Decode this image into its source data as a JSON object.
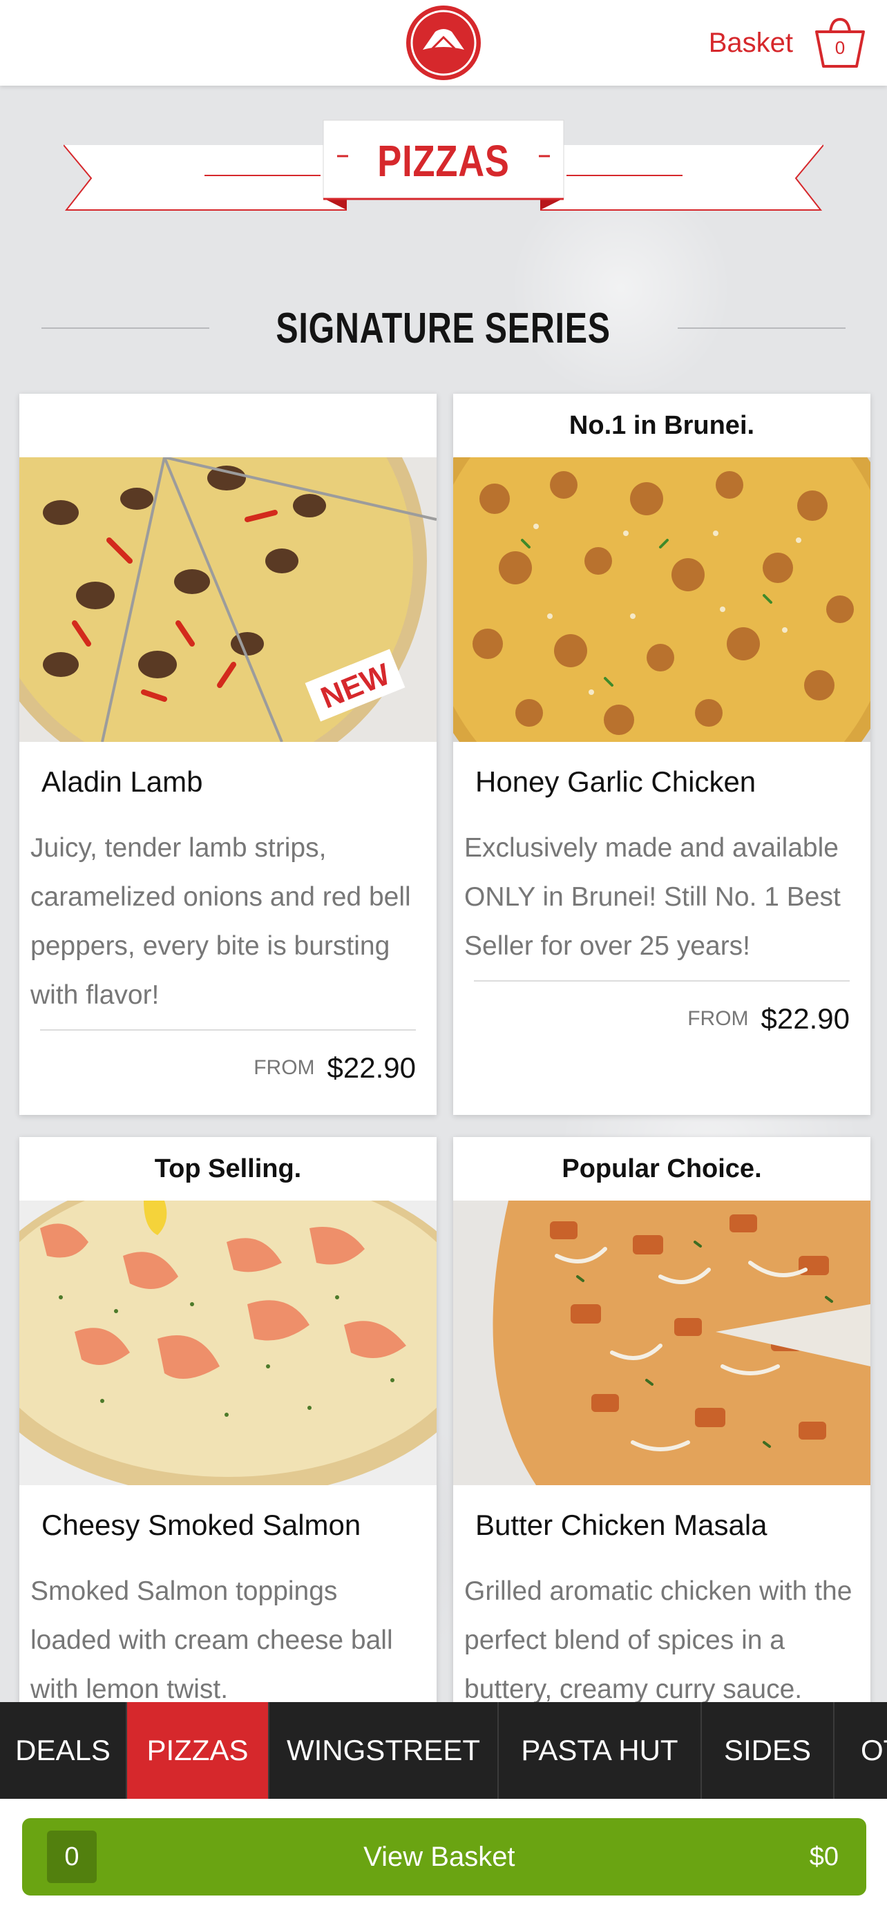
{
  "header": {
    "logo": "pizza-hut-logo",
    "basket_label": "Basket",
    "basket_count": "0"
  },
  "banner": {
    "title": "PIZZAS"
  },
  "section": {
    "title": "SIGNATURE SERIES"
  },
  "products": [
    {
      "tag": "",
      "name": "Aladin Lamb",
      "badge": "NEW",
      "description": "Juicy, tender lamb strips, caramelized onions and red bell peppers, every bite is bursting with flavor!",
      "from_label": "FROM",
      "price": "$22.90"
    },
    {
      "tag": "No.1 in Brunei.",
      "name": "Honey Garlic Chicken",
      "description": "Exclusively made and available ONLY in Brunei! Still No. 1 Best Seller for over 25 years!",
      "from_label": "FROM",
      "price": "$22.90"
    },
    {
      "tag": "Top Selling.",
      "name": "Cheesy Smoked Salmon",
      "description": "Smoked Salmon toppings loaded with cream cheese ball with lemon twist."
    },
    {
      "tag": "Popular Choice.",
      "name": "Butter Chicken Masala",
      "description": "Grilled aromatic chicken with the perfect blend of spices in a buttery, creamy curry sauce."
    }
  ],
  "category_nav": [
    {
      "label": "DEALS",
      "active": false
    },
    {
      "label": "PIZZAS",
      "active": true
    },
    {
      "label": "WINGSTREET",
      "active": false
    },
    {
      "label": "PASTA HUT",
      "active": false
    },
    {
      "label": "SIDES",
      "active": false
    },
    {
      "label": "OT",
      "active": false
    }
  ],
  "basket_bar": {
    "count": "0",
    "label": "View Basket",
    "total": "$0"
  },
  "colors": {
    "brand_red": "#d6282c",
    "basket_green": "#6aa412",
    "nav_dark": "#222222"
  }
}
